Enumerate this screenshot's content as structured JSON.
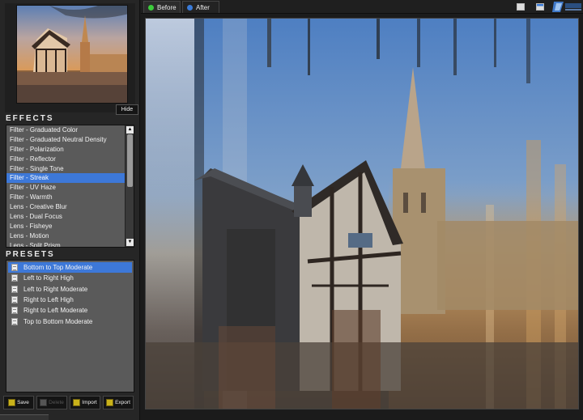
{
  "sidebar": {
    "hide_label": "Hide",
    "effects_title": "EFFECTS",
    "presets_title": "PRESETS",
    "effects": [
      "Filter - Graduated Color",
      "Filter - Graduated Neutral Density",
      "Filter - Polarization",
      "Filter - Reflector",
      "Filter - Single Tone",
      "Filter - Streak",
      "Filter - UV Haze",
      "Filter - Warmth",
      "Lens - Creative Blur",
      "Lens - Dual Focus",
      "Lens - Fisheye",
      "Lens - Motion",
      "Lens - Split Prism"
    ],
    "selected_effect": "Filter - Streak",
    "presets": [
      "Bottom to Top Moderate",
      "Left to Right High",
      "Left to Right Moderate",
      "Right to Left High",
      "Right to Left Moderate",
      "Top to Bottom Moderate"
    ],
    "selected_preset": "Bottom to Top Moderate",
    "buttons": {
      "save": "Save",
      "delete": "Delete",
      "import": "Import",
      "export": "Export"
    }
  },
  "topbar": {
    "tab_before": "Before",
    "tab_after": "After",
    "active_tab": "After"
  },
  "colors": {
    "selection": "#3d78d8",
    "panel": "#262626",
    "list_bg": "#5a5a5a",
    "before_dot": "#3ccc3c",
    "after_dot": "#3a7bd8"
  }
}
